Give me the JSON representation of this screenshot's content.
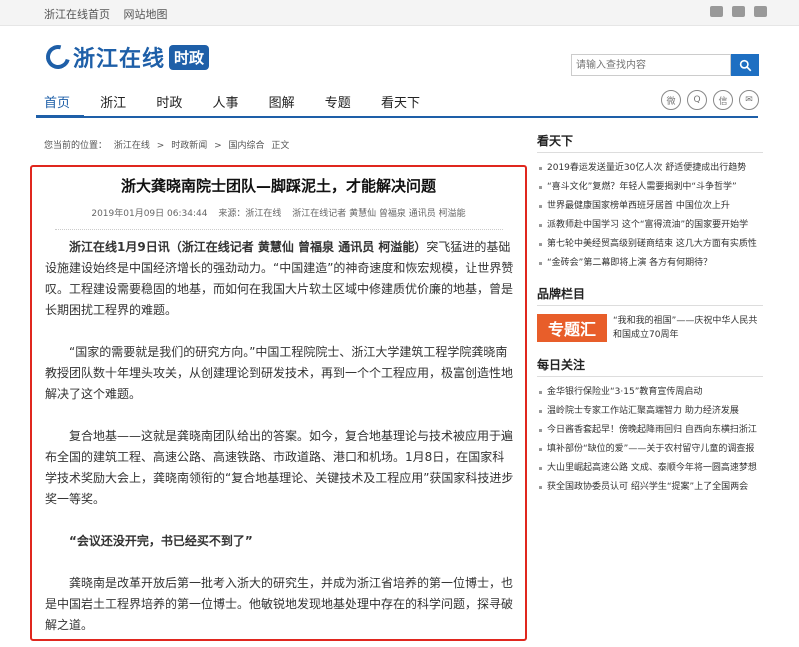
{
  "topbar": {
    "links": [
      "浙江在线首页",
      "网站地图"
    ]
  },
  "logo": {
    "name": "浙江在线",
    "channel": "时政"
  },
  "search": {
    "placeholder": "请输入查找内容"
  },
  "nav": {
    "items": [
      "首页",
      "浙江",
      "时政",
      "人事",
      "图解",
      "专题",
      "看天下"
    ]
  },
  "breadcrumb": {
    "prefix": "您当前的位置：",
    "items": [
      "浙江在线",
      ">",
      "时政新闻",
      ">",
      "国内综合",
      "正文"
    ]
  },
  "article": {
    "title": "浙大龚晓南院士团队—脚踩泥土，才能解决问题",
    "datetime": "2019年01月09日 06:34:44",
    "source": "来源：浙江在线",
    "authors": "浙江在线记者 黄慧仙 曾福泉 通讯员 柯溢能",
    "p1_lead": "浙江在线1月9日讯（浙江在线记者 黄慧仙 曾福泉 通讯员 柯溢能）",
    "p1_rest": "突飞猛进的基础设施建设始终是中国经济增长的强劲动力。“中国建造”的神奇速度和恢宏规模，让世界赞叹。工程建设需要稳固的地基，而如何在我国大片软土区域中修建质优价廉的地基，曾是长期困扰工程界的难题。",
    "p2": "“国家的需要就是我们的研究方向。”中国工程院院士、浙江大学建筑工程学院龚晓南教授团队数十年埋头攻关，从创建理论到研发技术，再到一个个工程应用，极富创造性地解决了这个难题。",
    "p3": "复合地基——这就是龚晓南团队给出的答案。如今，复合地基理论与技术被应用于遍布全国的建筑工程、高速公路、高速铁路、市政道路、港口和机场。1月8日，在国家科学技术奖励大会上，龚晓南领衔的“复合地基理论、关键技术及工程应用”获国家科技进步奖一等奖。",
    "subheading": "“会议还没开完，书已经买不到了”",
    "p4": "龚晓南是改革开放后第一批考入浙大的研究生，并成为浙江省培养的第一位博士，也是中国岩土工程界培养的第一位博士。他敏锐地发现地基处理中存在的科学问题，探寻破解之道。"
  },
  "sidebar": {
    "kantianxia": {
      "title": "看天下",
      "items": [
        "2019春运发送量近30亿人次 舒适便捷成出行趋势",
        "“喜斗文化”复燃？年轻人需要揭剥中“斗争哲学”",
        "世界最健康国家榜单西班牙居首 中国位次上升",
        "派教师赴中国学习 这个“富得流油”的国家要开始学",
        "第七轮中美经贸高级别磋商结束 这几大方面有实质性",
        "“金砖会”第二幕即将上演 各方有何期待？"
      ]
    },
    "brand": {
      "title": "品牌栏目",
      "badge": "专题汇",
      "text": "“我和我的祖国”——庆祝中华人民共和国成立70周年"
    },
    "daily": {
      "title": "每日关注",
      "items": [
        "金华银行保险业“3·15”教育宣传周启动",
        "温岭院士专家工作站汇聚高端智力 助力经济发展",
        "今日酱香套起早！傍晚起降雨回归 自西向东横扫浙江",
        "填补部份“缺位的爱”——关于农村留守儿童的调查报",
        "大山里崛起高速公路 文成、泰顺今年将一圆高速梦想",
        "获全国政协委员认可 绍兴学生“提案”上了全国两会"
      ]
    }
  }
}
